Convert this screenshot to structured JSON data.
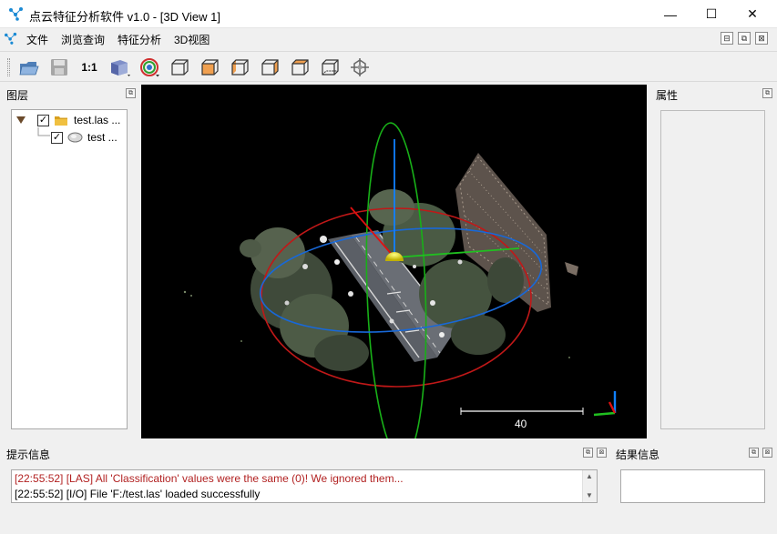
{
  "window": {
    "title": "点云特征分析软件 v1.0 - [3D View 1]",
    "minimize": "—",
    "maximize": "☐",
    "close": "✕"
  },
  "menu": {
    "items": [
      "文件",
      "浏览查询",
      "特征分析",
      "3D视图"
    ],
    "mdi": [
      "⊟",
      "⧉",
      "⊠"
    ]
  },
  "toolbar": {
    "zoom_label": "1:1",
    "tools": [
      "open-folder-icon",
      "save-icon",
      "one-to-one",
      "view-cube-icon",
      "point-pick-icon",
      "front-view-icon",
      "back-view-icon",
      "left-view-icon",
      "right-view-icon",
      "top-view-icon",
      "bottom-view-icon",
      "pivot-icon"
    ]
  },
  "layers_panel": {
    "title": "图层",
    "items": [
      {
        "label": "test.las ...",
        "checked": "✓",
        "expanded": true
      },
      {
        "label": "test ...",
        "checked": "✓"
      }
    ]
  },
  "view3d": {
    "scale_value": "40"
  },
  "properties_panel": {
    "title": "属性"
  },
  "info_panel": {
    "title": "提示信息",
    "logs": [
      {
        "text": "[22:55:52] [LAS] All 'Classification' values were the same (0)! We ignored them...",
        "color": "#b22222"
      },
      {
        "text": "[22:55:52] [I/O] File 'F:/test.las' loaded successfully",
        "color": "#000000"
      }
    ]
  },
  "result_panel": {
    "title": "结果信息"
  },
  "colors": {
    "axis_x": "#e01010",
    "axis_y": "#20c020",
    "axis_z": "#1080ff",
    "sphere_red": "#c01818",
    "sphere_green": "#18b018",
    "sphere_blue": "#1868d8",
    "pivot_yellow": "#e8e000"
  }
}
